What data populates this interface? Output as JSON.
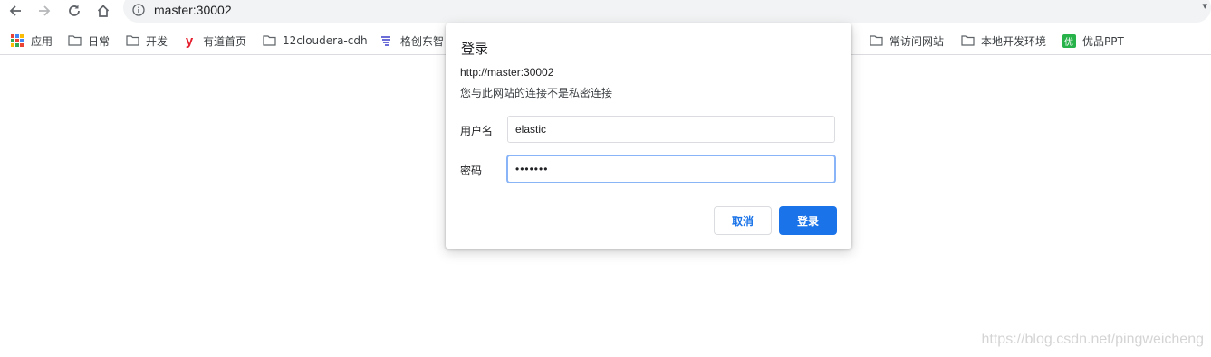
{
  "toolbar": {
    "url": "master:30002",
    "icons": [
      "back-icon",
      "forward-icon",
      "reload-icon",
      "home-icon",
      "info-icon"
    ]
  },
  "bookmarks": {
    "apps_label": "应用",
    "items": [
      {
        "label": "日常",
        "icon": "folder-icon"
      },
      {
        "label": "开发",
        "icon": "folder-icon"
      },
      {
        "label": "有道首页",
        "icon": "youdao-icon"
      },
      {
        "label": "12cloudera-cdh",
        "icon": "folder-icon"
      },
      {
        "label": "格创东智",
        "icon": "gechuang-icon"
      },
      {
        "label": "常访问网站",
        "icon": "folder-icon"
      },
      {
        "label": "本地开发环境",
        "icon": "folder-icon"
      },
      {
        "label": "优品PPT",
        "icon": "youpin-icon"
      }
    ]
  },
  "dialog": {
    "title": "登录",
    "url": "http://master:30002",
    "warning": "您与此网站的连接不是私密连接",
    "username_label": "用户名",
    "username_value": "elastic",
    "password_label": "密码",
    "password_value": "•••••••",
    "cancel_label": "取消",
    "login_label": "登录"
  },
  "watermark": "https://blog.csdn.net/pingweicheng",
  "colors": {
    "accent": "#1a73e8",
    "youdao": "#e5202e",
    "youpin": "#27b24a"
  }
}
